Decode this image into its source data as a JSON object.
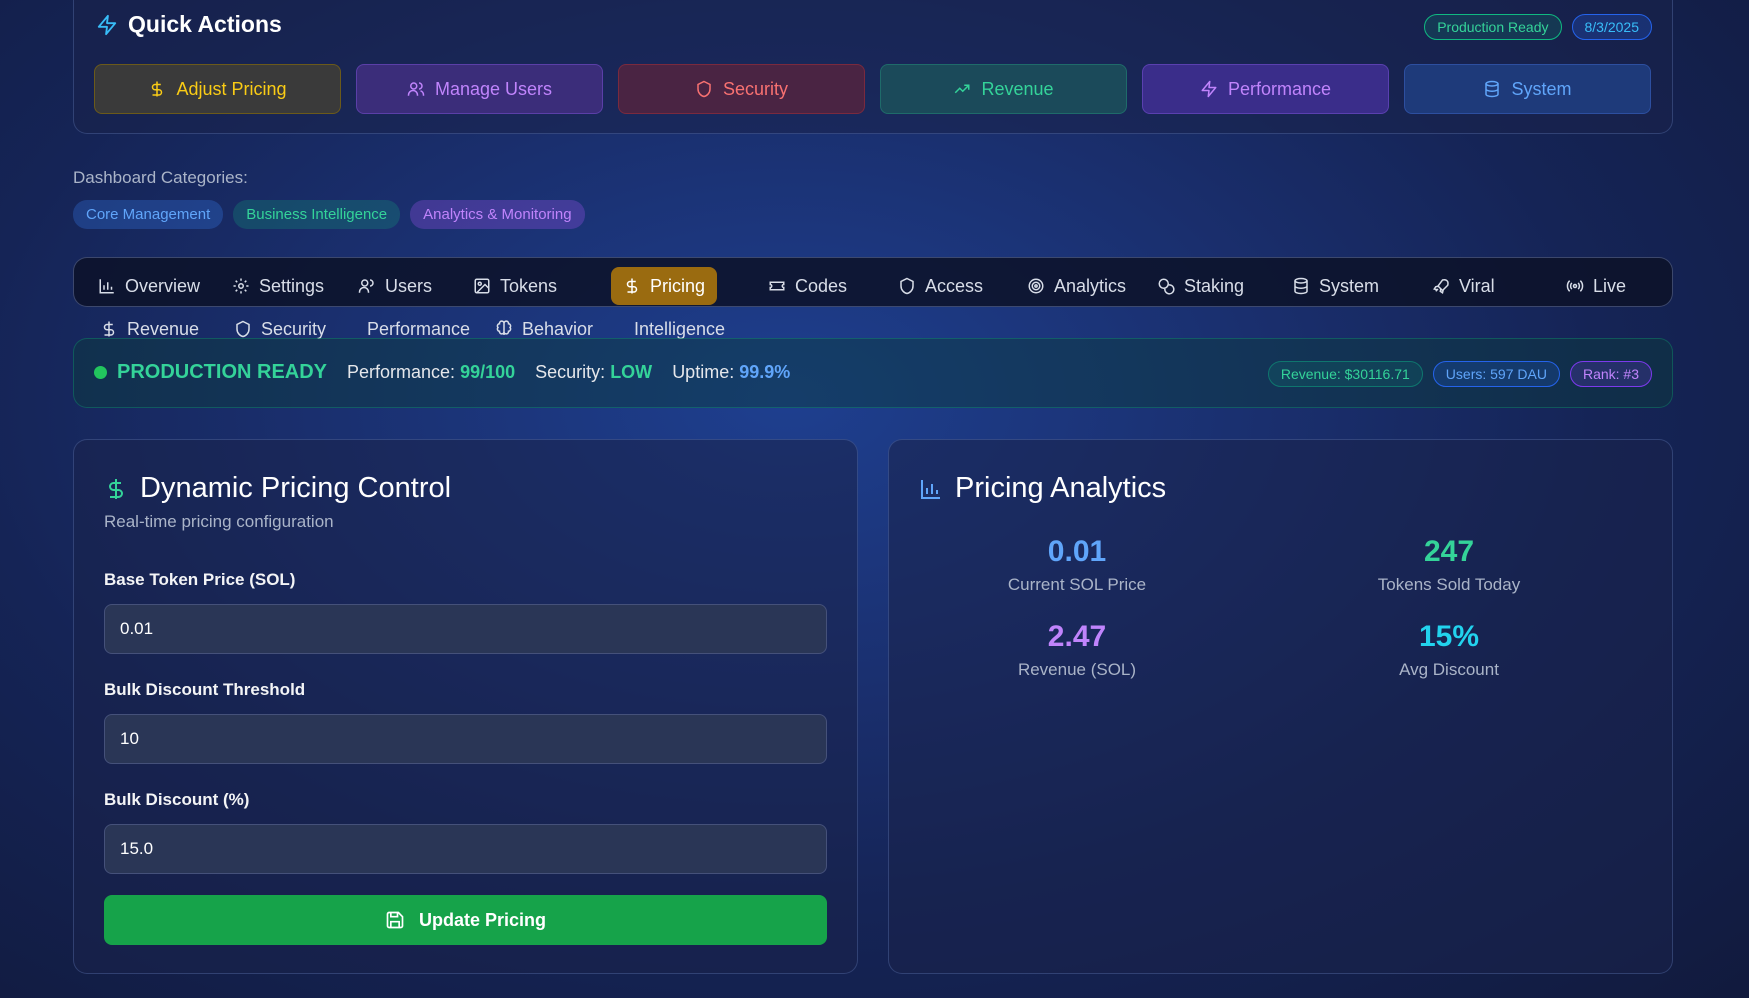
{
  "quick_actions": {
    "title": "Quick Actions",
    "status_badge": "Production Ready",
    "date_badge": "8/3/2025",
    "buttons": [
      {
        "label": "Adjust Pricing",
        "icon": "dollar-icon"
      },
      {
        "label": "Manage Users",
        "icon": "users-icon"
      },
      {
        "label": "Security",
        "icon": "shield-icon"
      },
      {
        "label": "Revenue",
        "icon": "trending-up-icon"
      },
      {
        "label": "Performance",
        "icon": "zap-icon"
      },
      {
        "label": "System",
        "icon": "database-icon"
      }
    ]
  },
  "categories": {
    "label": "Dashboard Categories:",
    "items": [
      "Core Management",
      "Business Intelligence",
      "Analytics & Monitoring"
    ]
  },
  "tabs": {
    "row1": [
      "Overview",
      "Settings",
      "Users",
      "Tokens",
      "Pricing",
      "Codes",
      "Access",
      "Analytics",
      "Staking",
      "System",
      "Viral",
      "Live"
    ],
    "row2": [
      "Revenue",
      "Security",
      "Performance",
      "Behavior",
      "Intelligence"
    ],
    "active": "Pricing"
  },
  "status_strip": {
    "title": "PRODUCTION READY",
    "performance_label": "Performance:",
    "performance_value": "99/100",
    "security_label": "Security:",
    "security_value": "LOW",
    "uptime_label": "Uptime:",
    "uptime_value": "99.9%",
    "revenue_pill": "Revenue: $30116.71",
    "users_pill": "Users: 597 DAU",
    "rank_pill": "Rank: #3"
  },
  "pricing_control": {
    "title": "Dynamic Pricing Control",
    "subtitle": "Real-time pricing configuration",
    "fields": [
      {
        "label": "Base Token Price (SOL)",
        "value": "0.01"
      },
      {
        "label": "Bulk Discount Threshold",
        "value": "10"
      },
      {
        "label": "Bulk Discount (%)",
        "value": "15.0"
      }
    ],
    "button_label": "Update Pricing"
  },
  "pricing_analytics": {
    "title": "Pricing Analytics",
    "metrics": [
      {
        "value": "0.01",
        "label": "Current SOL Price",
        "color": "#60a5fa"
      },
      {
        "value": "247",
        "label": "Tokens Sold Today",
        "color": "#34d399"
      },
      {
        "value": "2.47",
        "label": "Revenue (SOL)",
        "color": "#c084fc"
      },
      {
        "value": "15%",
        "label": "Avg Discount",
        "color": "#22d3ee"
      }
    ]
  }
}
